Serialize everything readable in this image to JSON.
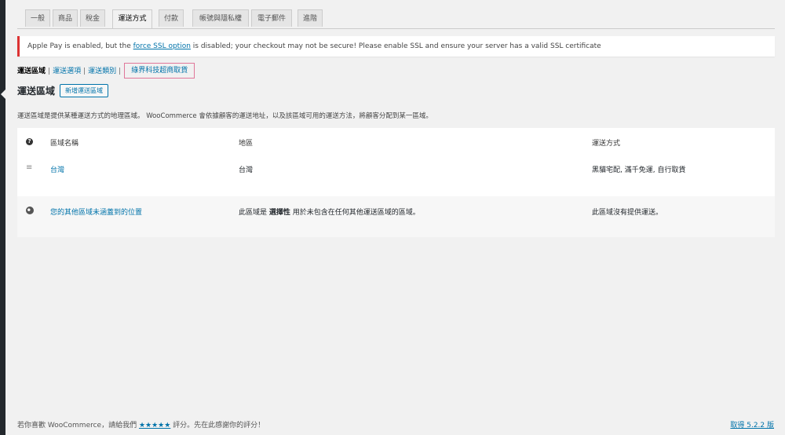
{
  "tabs": [
    {
      "label": "一般"
    },
    {
      "label": "商品"
    },
    {
      "label": "稅金"
    },
    {
      "label": "運送方式",
      "active": true
    },
    {
      "label": "付款"
    },
    {
      "label": "帳號與隱私權"
    },
    {
      "label": "電子郵件"
    },
    {
      "label": "進階"
    }
  ],
  "notice": {
    "before": "Apple Pay is enabled, but the ",
    "link": "force SSL option",
    "after": " is disabled; your checkout may not be secure! Please enable SSL and ensure your server has a valid SSL certificate",
    "color": "#dc3232"
  },
  "subnav": {
    "current": "運送區域",
    "items": [
      "運送選項",
      "運送類別"
    ],
    "highlighted": "綠界科技超商取貨",
    "highlight_color": "#e0779a"
  },
  "heading": {
    "title": "運送區域",
    "add_button": "新增運送區域"
  },
  "description": "運送區域是提供某種運送方式的地理區域。 WooCommerce 會依據顧客的運送地址，以及該區域可用的運送方法，將顧客分配到某一區域。",
  "table": {
    "headers": {
      "name": "區域名稱",
      "region": "地區",
      "methods": "運送方式"
    },
    "rows": [
      {
        "name": "台灣",
        "region": "台灣",
        "methods": "黑貓宅配, 滿千免運, 自行取貨",
        "icon": "drag-handle-icon"
      },
      {
        "name": "您的其他區域未涵蓋到的位置",
        "region_before": "此區域是 ",
        "region_bold": "選擇性",
        "region_after": " 用於未包含在任何其他運送區域的區域。",
        "methods": "此區域沒有提供運送。",
        "icon": "globe-icon"
      }
    ]
  },
  "footer": {
    "before": "若你喜歡 WooCommerce，請給我們 ",
    "stars": "★★★★★",
    "after": " 評分。先在此感謝你的評分！",
    "version": "取得 5.2.2 版"
  },
  "colors": {
    "accent": "#0073aa",
    "admin_bar": "#23282d",
    "background": "#f1f1f1"
  }
}
